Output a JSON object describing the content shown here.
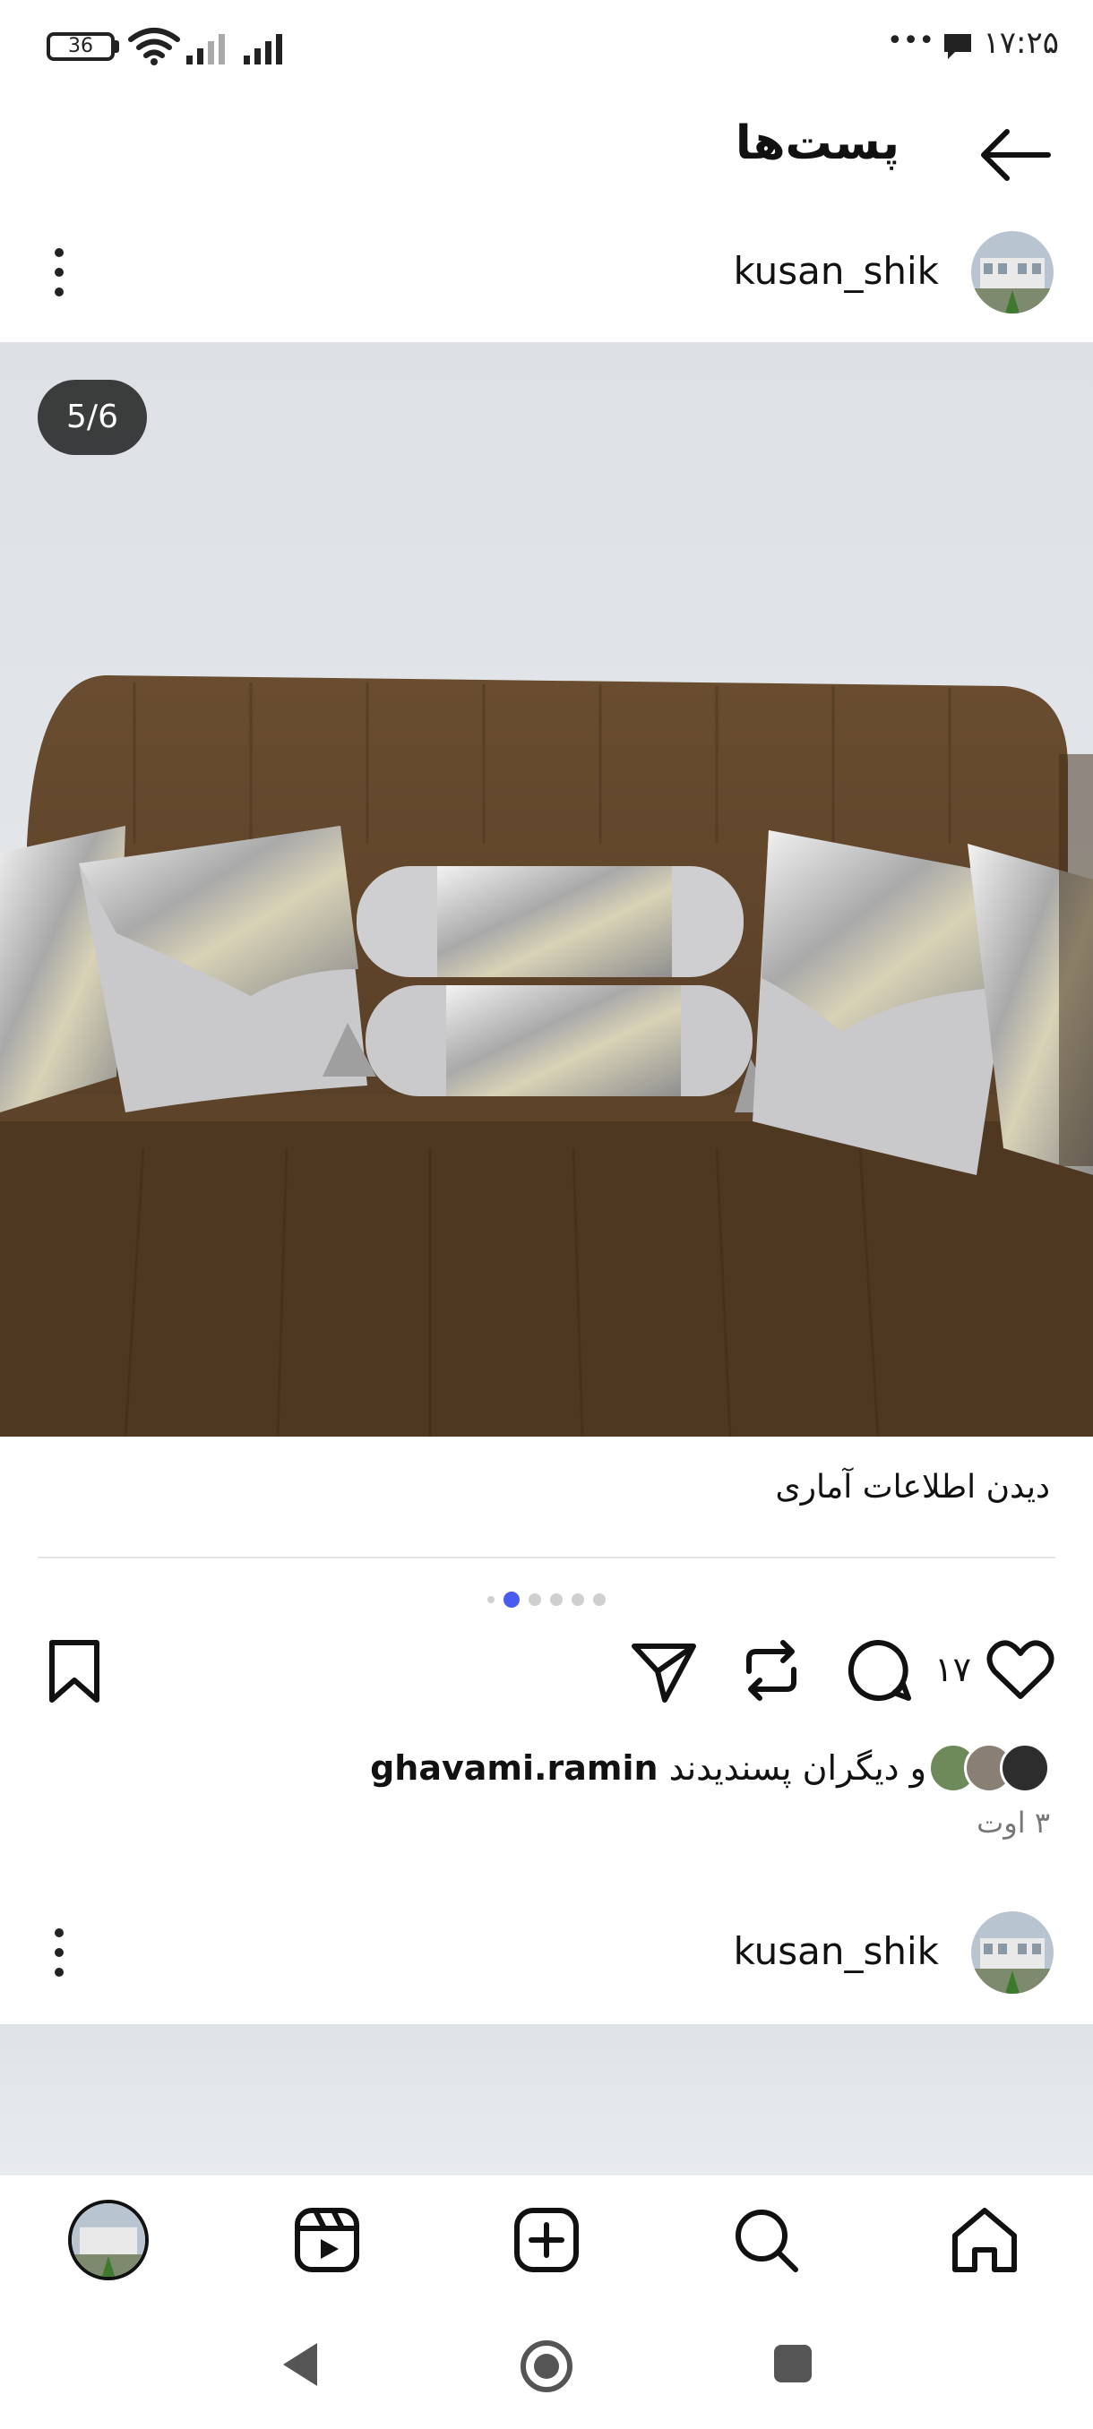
{
  "status_bar": {
    "battery": "36",
    "time": "۱۷:۲۵",
    "more": "•••"
  },
  "header": {
    "title": "پست‌ها"
  },
  "post": {
    "username": "kusan_shik",
    "slide_counter": "5/6",
    "insights_link": "دیدن اطلاعات آماری",
    "likes_count": "۱۷",
    "liked_by_user": "ghavami.ramin",
    "liked_by_suffix": "و دیگران پسندیدند",
    "date": "۳ اوت",
    "slides_total": 6,
    "slide_active": 2
  },
  "next_post": {
    "username": "kusan_shik"
  },
  "colors": {
    "accent_dot": "#4a5cf0",
    "sofa": "#5a4127",
    "sequin": "#c9c9c9"
  },
  "icons": [
    "back-arrow-icon",
    "more-vertical-icon",
    "bookmark-icon",
    "send-icon",
    "repost-icon",
    "comment-icon",
    "heart-icon",
    "home-icon",
    "search-icon",
    "add-icon",
    "reels-icon",
    "profile-icon"
  ]
}
